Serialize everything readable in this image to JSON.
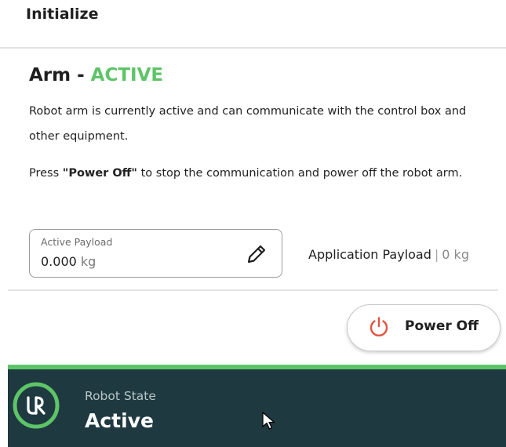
{
  "header": {
    "title": "Initialize"
  },
  "arm": {
    "title_prefix": "Arm - ",
    "status": "ACTIVE",
    "status_color": "#5ec468",
    "description": "Robot arm is currently active and can communicate with the control box and other equipment.",
    "instruction_prefix": "Press ",
    "instruction_action": "\"Power Off\"",
    "instruction_suffix": " to stop the communication and power off the robot arm."
  },
  "payload": {
    "active_label": "Active Payload",
    "active_value": "0.000",
    "active_unit": "kg",
    "edit_icon": "pencil-icon",
    "application_label": "Application Payload",
    "separator": "|",
    "application_value": "0 kg"
  },
  "power": {
    "label": "Power Off",
    "icon": "power-icon",
    "icon_color": "#e0533f"
  },
  "robot_state": {
    "label": "Robot State",
    "value": "Active",
    "logo": "ur-logo-icon",
    "accent_color": "#5ec468",
    "background_color": "#1e3a40"
  }
}
